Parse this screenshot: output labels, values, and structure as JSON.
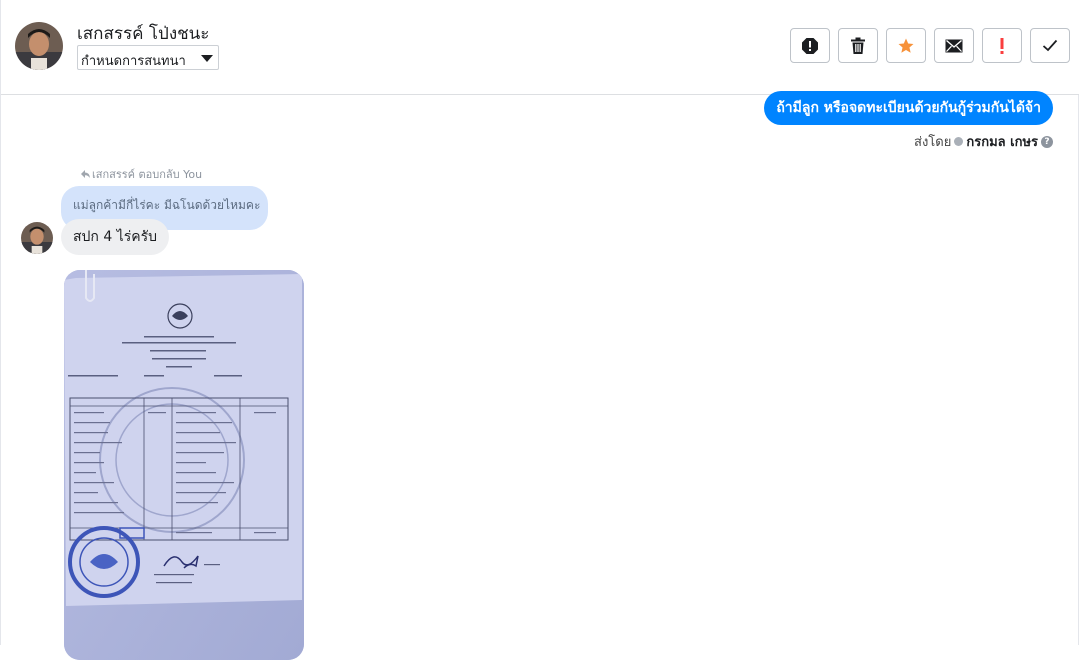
{
  "header": {
    "contact_name": "เสกสรรค์ โป่งชนะ",
    "assign_label": "กำหนดการสนทนา",
    "actions": [
      {
        "name": "report-spam-button",
        "icon": "alert-octagon-icon"
      },
      {
        "name": "delete-button",
        "icon": "trash-icon"
      },
      {
        "name": "star-button",
        "icon": "star-icon",
        "color": "#f7923a"
      },
      {
        "name": "mark-unread-button",
        "icon": "envelope-icon"
      },
      {
        "name": "follow-up-button",
        "icon": "exclamation-icon",
        "color": "#fa3e3e"
      },
      {
        "name": "mark-done-button",
        "icon": "checkmark-icon"
      }
    ]
  },
  "messages": {
    "outgoing_text": "ถ้ามีลูก หรือจดทะเบียนด้วยกันกู้ร่วมกันได้จ้า",
    "sent_by_label": "ส่งโดย",
    "sender_name": "กรกมล เกษร",
    "reply_label": "เสกสรรค์ ตอบกลับ You",
    "quoted_text": "แม่ลูกค้ามีกี่ไร่คะ มีฉโนดด้วยไหมคะ",
    "incoming_text": "สปก  4 ไร่ครับ"
  },
  "colors": {
    "accent": "#0084ff",
    "quoted_bg": "#d4e3fb",
    "incoming_bg": "#eeeff1",
    "star": "#f7923a",
    "alert": "#fa3e3e"
  }
}
